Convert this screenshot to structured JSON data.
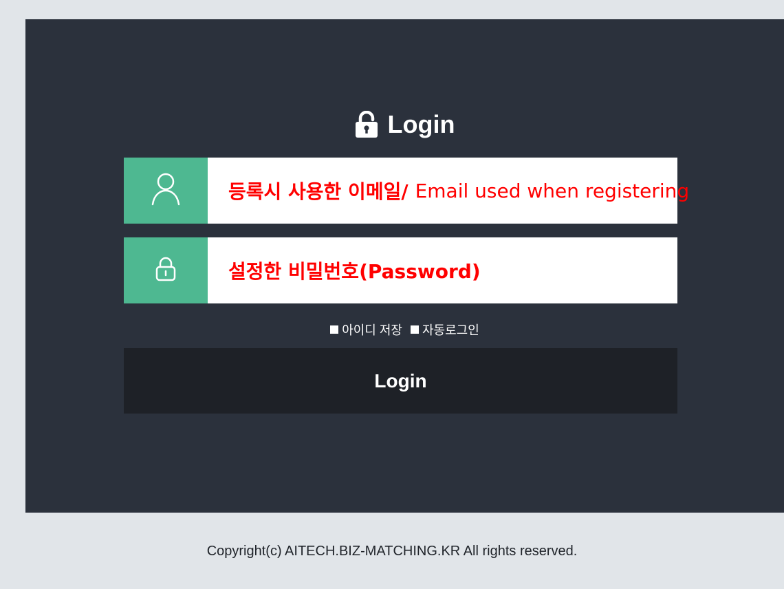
{
  "header": {
    "title": "Login",
    "title_icon": "padlock-icon"
  },
  "email_field": {
    "icon": "user-icon",
    "value_korean": "등록시 사용한 이메일/",
    "value_english": "Email used when registering"
  },
  "password_field": {
    "icon": "lock-icon",
    "value": "설정한 비밀번호(Password)"
  },
  "options": {
    "save_id_label": "아이디 저장",
    "auto_login_label": "자동로그인"
  },
  "login_button": {
    "label": "Login"
  },
  "footer": {
    "copyright": "Copyright(c) AITECH.BIZ-MATCHING.KR All rights reserved."
  },
  "colors": {
    "page_background": "#e1e5e9",
    "panel_background": "#2b313c",
    "icon_box": "#4eb891",
    "annotation_text": "#ff0000",
    "button_background": "#1e2127"
  }
}
